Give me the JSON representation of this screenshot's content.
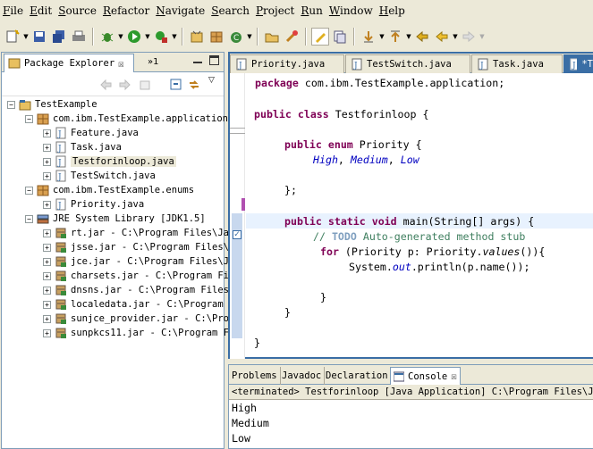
{
  "menu": [
    "File",
    "Edit",
    "Source",
    "Refactor",
    "Navigate",
    "Search",
    "Project",
    "Run",
    "Window",
    "Help"
  ],
  "package_explorer": {
    "title": "Package Explorer",
    "more_count": "»1",
    "tree": [
      {
        "label": "TestExample",
        "depth": 0,
        "toggle": "−",
        "icon": "project-icon"
      },
      {
        "label": "com.ibm.TestExample.application",
        "depth": 1,
        "toggle": "−",
        "icon": "package-icon"
      },
      {
        "label": "Feature.java",
        "depth": 2,
        "toggle": "+",
        "icon": "java-file-icon"
      },
      {
        "label": "Task.java",
        "depth": 2,
        "toggle": "+",
        "icon": "java-file-icon"
      },
      {
        "label": "Testforinloop.java",
        "depth": 2,
        "toggle": "+",
        "icon": "java-file-icon",
        "selected": true
      },
      {
        "label": "TestSwitch.java",
        "depth": 2,
        "toggle": "+",
        "icon": "java-file-icon"
      },
      {
        "label": "com.ibm.TestExample.enums",
        "depth": 1,
        "toggle": "−",
        "icon": "package-icon"
      },
      {
        "label": "Priority.java",
        "depth": 2,
        "toggle": "+",
        "icon": "java-file-icon"
      },
      {
        "label": "JRE System Library [JDK1.5]",
        "depth": 1,
        "toggle": "−",
        "icon": "library-icon"
      },
      {
        "label": "rt.jar - C:\\Program Files\\Ja",
        "depth": 2,
        "toggle": "+",
        "icon": "jar-icon"
      },
      {
        "label": "jsse.jar - C:\\Program Files\\",
        "depth": 2,
        "toggle": "+",
        "icon": "jar-icon"
      },
      {
        "label": "jce.jar - C:\\Program Files\\J",
        "depth": 2,
        "toggle": "+",
        "icon": "jar-icon"
      },
      {
        "label": "charsets.jar - C:\\Program Fi",
        "depth": 2,
        "toggle": "+",
        "icon": "jar-icon"
      },
      {
        "label": "dnsns.jar - C:\\Program Files",
        "depth": 2,
        "toggle": "+",
        "icon": "jar-icon"
      },
      {
        "label": "localedata.jar - C:\\Program",
        "depth": 2,
        "toggle": "+",
        "icon": "jar-icon"
      },
      {
        "label": "sunjce_provider.jar - C:\\Pro",
        "depth": 2,
        "toggle": "+",
        "icon": "jar-icon"
      },
      {
        "label": "sunpkcs11.jar - C:\\Program F",
        "depth": 2,
        "toggle": "+",
        "icon": "jar-icon"
      }
    ]
  },
  "editor": {
    "tabs": [
      "Priority.java",
      "TestSwitch.java",
      "Task.java",
      "*T"
    ],
    "code": {
      "l1_kw": "package",
      "l1_rest": " com.ibm.TestExample.application;",
      "l2_kw": "public class",
      "l2_rest": " Testforinloop {",
      "l3_kw": "public enum",
      "l3_rest": " Priority {",
      "l4_a": "High",
      "l4_s1": ", ",
      "l4_b": "Medium",
      "l4_s2": ", ",
      "l4_c": "Low",
      "l5": "};",
      "l6_kw": "public static void",
      "l6_rest": " main(String[] args) {",
      "l7_a": "// ",
      "l7_todo": "TODO",
      "l7_b": " Auto-generated method stub",
      "l8_kw": "for",
      "l8_a": " (Priority p: Priority.",
      "l8_m": "values",
      "l8_b": "()){",
      "l9_a": "System.",
      "l9_out": "out",
      "l9_b": ".println(p.name());",
      "l10": "}",
      "l11": "}",
      "l12": "}"
    }
  },
  "console": {
    "tabs": [
      "Problems",
      "Javadoc",
      "Declaration",
      "Console"
    ],
    "status": "<terminated> Testforinloop [Java Application] C:\\Program Files\\Java\\",
    "output": [
      "High",
      "Medium",
      "Low"
    ]
  },
  "colors": {
    "keyword": "#7f0055",
    "field": "#0000c0",
    "comment": "#3f7f5f",
    "selection": "#3a6ea5"
  }
}
